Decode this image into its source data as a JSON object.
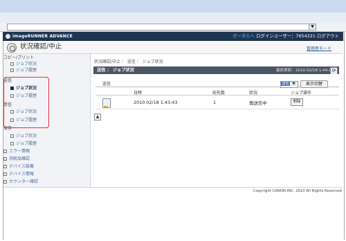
{
  "address_bar": {
    "dropdown_glyph": "▼"
  },
  "app": {
    "name": "imageRUNNER ADVANCE",
    "portal_link": "ポータルへ",
    "login_user": "ログインユーザー：7654321 ログアウト"
  },
  "header": {
    "title": "状況確認/中止",
    "admin_mode": "管理者モード"
  },
  "sidebar": {
    "groups": [
      {
        "label": "コピー/プリント",
        "items": [
          {
            "label": "ジョブ状況",
            "selected": false
          },
          {
            "label": "ジョブ履歴",
            "selected": false
          }
        ]
      },
      {
        "label": "送信",
        "items": [
          {
            "label": "ジョブ状況",
            "selected": true
          },
          {
            "label": "ジョブ履歴",
            "selected": false
          }
        ]
      },
      {
        "label": "受信",
        "items": [
          {
            "label": "ジョブ状況",
            "selected": false
          },
          {
            "label": "ジョブ履歴",
            "selected": false
          }
        ]
      },
      {
        "label": "保存",
        "items": [
          {
            "label": "ジョブ状況",
            "selected": false
          },
          {
            "label": "ジョブ履歴",
            "selected": false
          }
        ]
      }
    ],
    "links": [
      "エラー情報",
      "消耗品確認",
      "デバイス装備",
      "デバイス情報",
      "カウンター確認"
    ]
  },
  "main": {
    "breadcrumb": "状況確認/中止 ： 送信 ： ジョブ状況",
    "panel_title": "送信 ： ジョブ状況",
    "last_update": "最終更新：2010 02/18 1:44:06",
    "refresh_icon": "⟳",
    "section_label": "送信",
    "select_value": "送信",
    "select_arrow": "▼",
    "show_button": "表示切替",
    "columns": [
      "日時",
      "宛先数",
      "状況",
      "ジョブ操作"
    ],
    "rows": [
      {
        "datetime": "2010 02/18 1:43:43",
        "destinations": "1",
        "status": "再送信中",
        "action": "削除"
      }
    ],
    "top_button": "▲"
  },
  "footer": {
    "copyright": "Copyright CANON INC. 2010 All Rights Reserved"
  }
}
